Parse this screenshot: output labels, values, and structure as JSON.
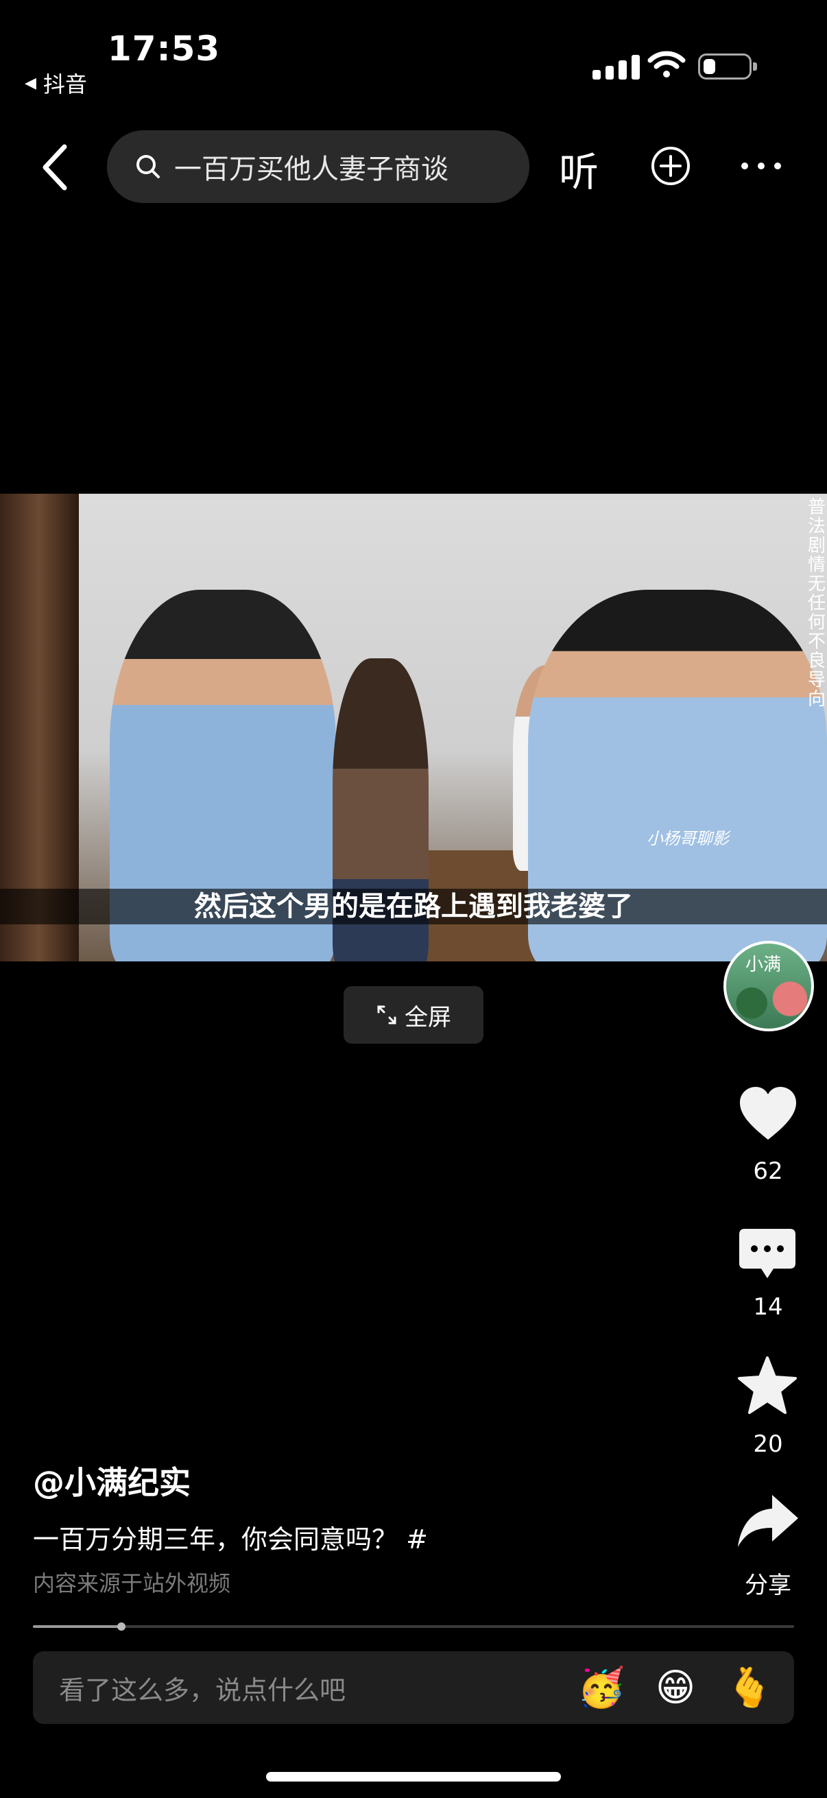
{
  "status_bar": {
    "time": "17:53",
    "back_app_label": "抖音",
    "battery_level": 0.25
  },
  "nav": {
    "search_text": "一百万买他人妻子商谈",
    "listen_label": "听",
    "icons": [
      "back-arrow-icon",
      "search-icon",
      "plus-circle-icon",
      "more-icon"
    ]
  },
  "video": {
    "vertical_notice": "普法剧情 无任何不良导向",
    "watermark": "小杨哥聊影",
    "subtitle": "然后这个男的是在路上遇到我老婆了",
    "fullscreen_label": "全屏"
  },
  "rail": {
    "avatar_text": "小满",
    "likes": "62",
    "comments": "14",
    "favorites": "20",
    "share_label": "分享"
  },
  "post": {
    "author": "@小满纪实",
    "description": "一百万分期三年，你会同意吗？ #",
    "source_note": "内容来源于站外视频",
    "progress": 0.116
  },
  "comment": {
    "placeholder": "看了这么多，说点什么吧",
    "emojis": [
      "🥳",
      "😁",
      "🫰"
    ]
  },
  "colors": {
    "background": "#000000",
    "search_bg": "#2a2a2a",
    "comment_bg": "#1f1f1f",
    "muted_text": "#7b7b7b"
  }
}
